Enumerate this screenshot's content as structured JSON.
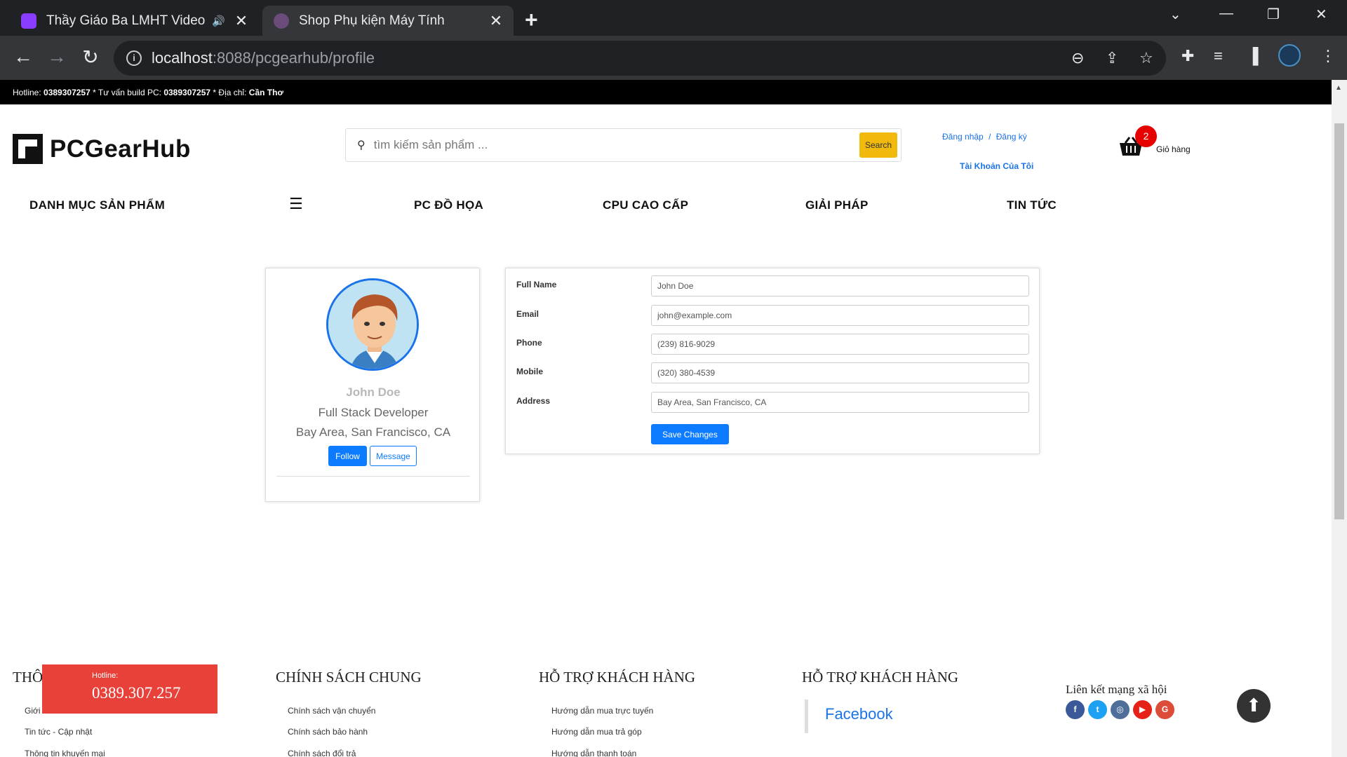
{
  "browser": {
    "tabs": [
      {
        "title": "Thầy Giáo Ba LMHT Video Phát lại",
        "fav_color": "#8b3dff"
      },
      {
        "title": "Shop Phụ kiện Máy Tính",
        "fav_color": "#6b4b7a"
      }
    ],
    "url_host": "localhost",
    "url_path": ":8088/pcgearhub/profile"
  },
  "topbar": {
    "hotline_label": "Hotline:",
    "hotline": "0389307257",
    "build_label": " * Tư vấn build PC:",
    "build_phone": "0389307257",
    "address_label": " * Địa chỉ:",
    "address": "Cần Thơ"
  },
  "header": {
    "logo_text": "PCGearHub",
    "search_placeholder": "tìm kiếm sản phẩm ...",
    "search_button": "Search",
    "login": "Đăng nhập",
    "separator": "/",
    "register": "Đăng ký",
    "account": "Tài Khoản Của Tôi",
    "cart_count": "2",
    "cart_label": "Giỏ hàng"
  },
  "menu": {
    "categories": "DANH MỤC SẢN PHẨM",
    "items": [
      "PC ĐỒ HỌA",
      "CPU CAO CẤP",
      "GIẢI PHÁP",
      "TIN TỨC"
    ]
  },
  "profile": {
    "name": "John Doe",
    "role": "Full Stack Developer",
    "location": "Bay Area, San Francisco, CA",
    "follow": "Follow",
    "message": "Message"
  },
  "form": {
    "fields": [
      {
        "label": "Full Name",
        "value": "John Doe"
      },
      {
        "label": "Email",
        "value": "john@example.com"
      },
      {
        "label": "Phone",
        "value": "(239) 816-9029"
      },
      {
        "label": "Mobile",
        "value": "(320) 380-4539"
      },
      {
        "label": "Address",
        "value": "Bay Area, San Francisco, CA"
      }
    ],
    "save": "Save Changes"
  },
  "footer": {
    "col1_title": "THÔ",
    "col1_links": [
      "Giới",
      "Tin tức - Cập nhật",
      "Thông tin khuyến mại"
    ],
    "col2_title": "CHÍNH SÁCH CHUNG",
    "col2_links": [
      "Chính sách vận chuyển",
      "Chính sách bảo hành",
      "Chính sách đổi trả"
    ],
    "col3_title": "HỖ TRỢ KHÁCH HÀNG",
    "col3_links": [
      "Hướng dẫn mua trực tuyến",
      "Hướng dẫn mua trả góp",
      "Hướng dẫn thanh toán"
    ],
    "col4_title": "HỖ TRỢ KHÁCH HÀNG",
    "facebook": "Facebook",
    "social_title": "Liên kết mạng xã hội",
    "hotline_label": "Hotline:",
    "hotline_number": "0389.307.257"
  }
}
